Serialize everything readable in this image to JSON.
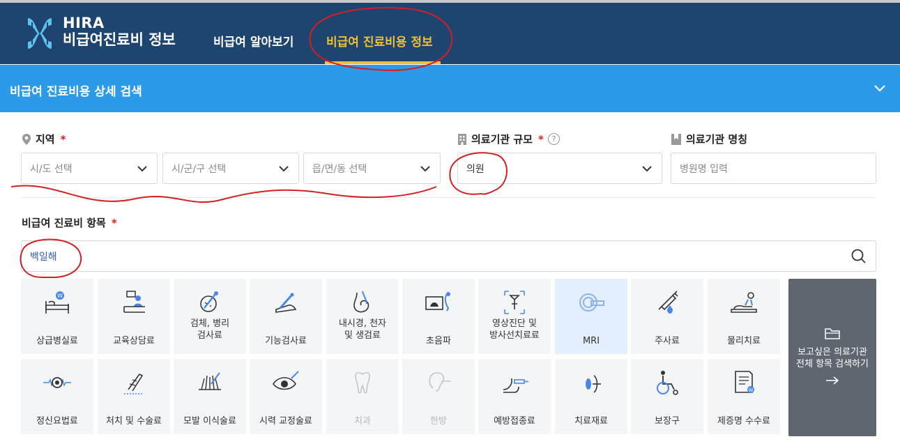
{
  "header": {
    "logo_text": "HIRA",
    "logo_subtitle": "비급여진료비 정보",
    "nav": [
      {
        "label": "비급여 알아보기"
      },
      {
        "label": "비급여 진료비용 정보"
      }
    ]
  },
  "banner": {
    "title": "비급여 진료비용 상세 검색"
  },
  "region": {
    "label": "지역",
    "required_mark": "*",
    "selects": [
      {
        "placeholder": "시/도 선택"
      },
      {
        "placeholder": "시/군/구 선택"
      },
      {
        "placeholder": "읍/면/동 선택"
      }
    ]
  },
  "institution_scale": {
    "label": "의료기관 규모",
    "required_mark": "*",
    "help": "?",
    "value": "의원"
  },
  "institution_name": {
    "label": "의료기관 명칭",
    "placeholder": "병원명 입력"
  },
  "items": {
    "label": "비급여 진료비 항목",
    "required_mark": "*",
    "search_value": "백일해",
    "tiles": [
      {
        "label": "상급병실료",
        "icon": "hospital-bed-icon"
      },
      {
        "label": "교육상담료",
        "icon": "counseling-desk-icon"
      },
      {
        "label": "검체, 병리\n검사료",
        "icon": "specimen-test-icon"
      },
      {
        "label": "기능검사료",
        "icon": "function-test-icon"
      },
      {
        "label": "내시경, 천자\n및 생검료",
        "icon": "endoscope-icon"
      },
      {
        "label": "초음파",
        "icon": "ultrasound-icon"
      },
      {
        "label": "영상진단 및\n방사선치료료",
        "icon": "xray-imaging-icon"
      },
      {
        "label": "MRI",
        "icon": "mri-icon",
        "selected": true
      },
      {
        "label": "주사료",
        "icon": "syringe-icon"
      },
      {
        "label": "물리치료",
        "icon": "physical-therapy-icon"
      },
      {
        "label": "정신요법료",
        "icon": "brainwave-icon"
      },
      {
        "label": "처치 및 수술료",
        "icon": "scalpel-icon"
      },
      {
        "label": "모발 이식술료",
        "icon": "hair-transplant-icon"
      },
      {
        "label": "시력 교정술료",
        "icon": "eye-surgery-icon"
      },
      {
        "label": "치과",
        "icon": "tooth-icon",
        "disabled": true
      },
      {
        "label": "한방",
        "icon": "ear-acupuncture-icon",
        "disabled": true
      },
      {
        "label": "예방접종료",
        "icon": "vaccination-icon"
      },
      {
        "label": "치료재료",
        "icon": "treatment-material-icon"
      },
      {
        "label": "보장구",
        "icon": "wheelchair-icon"
      },
      {
        "label": "제증명 수수료",
        "icon": "certificate-icon"
      }
    ],
    "all_search_button": {
      "label": "보고싶은 의료기관\n전체 항목 검색하기",
      "icon": "folder-icon",
      "arrow": "→"
    }
  },
  "colors": {
    "header_bg": "#1e4470",
    "banner_bg": "#2b9ae9",
    "active_nav": "#f3c033",
    "annotation": "#d42020",
    "tile_bg": "#f4f5f7",
    "selected_tile_bg": "#e3effd"
  }
}
